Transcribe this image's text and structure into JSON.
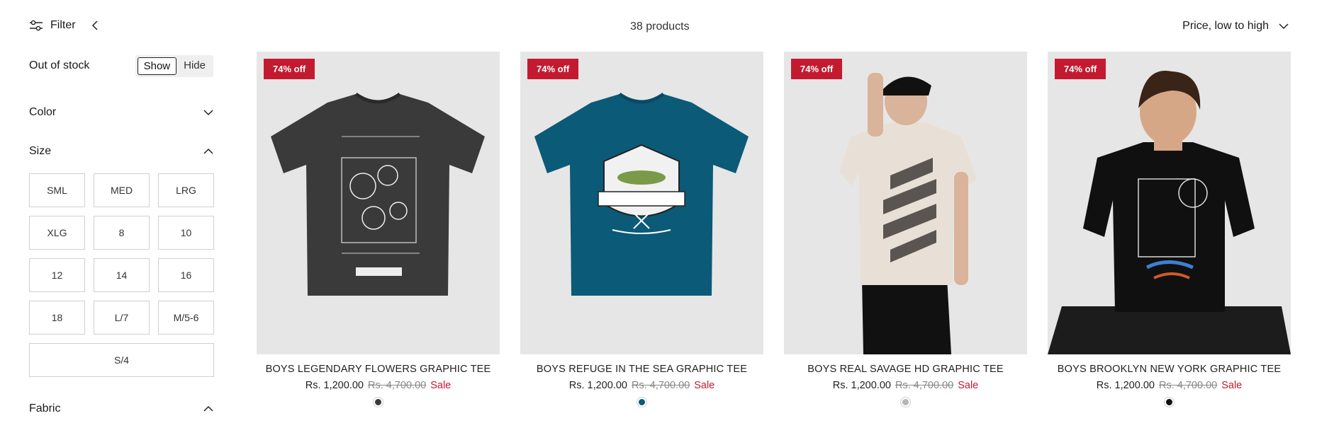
{
  "toolbar": {
    "filter_label": "Filter",
    "product_count": "38 products",
    "sort_label": "Price, low to high"
  },
  "sidebar": {
    "out_of_stock": {
      "label": "Out of stock",
      "options": [
        "Show",
        "Hide"
      ],
      "selected": "Show"
    },
    "color": {
      "label": "Color",
      "expanded": false
    },
    "size": {
      "label": "Size",
      "expanded": true,
      "options": [
        "SML",
        "MED",
        "LRG",
        "XLG",
        "8",
        "10",
        "12",
        "14",
        "16",
        "18",
        "L/7",
        "M/5-6",
        "S/4"
      ]
    },
    "fabric": {
      "label": "Fabric",
      "expanded": true
    }
  },
  "products": [
    {
      "badge": "74% off",
      "title": "BOYS LEGENDARY FLOWERS GRAPHIC TEE",
      "price": "Rs. 1,200.00",
      "compare_price": "Rs. 4,700.00",
      "sale_label": "Sale",
      "swatch": "#3a3a3a"
    },
    {
      "badge": "74% off",
      "title": "BOYS REFUGE IN THE SEA GRAPHIC TEE",
      "price": "Rs. 1,200.00",
      "compare_price": "Rs. 4,700.00",
      "sale_label": "Sale",
      "swatch": "#0b5a78"
    },
    {
      "badge": "74% off",
      "title": "BOYS REAL SAVAGE HD GRAPHIC TEE",
      "price": "Rs. 1,200.00",
      "compare_price": "Rs. 4,700.00",
      "sale_label": "Sale",
      "swatch": "#b5b5b5"
    },
    {
      "badge": "74% off",
      "title": "BOYS BROOKLYN NEW YORK GRAPHIC TEE",
      "price": "Rs. 1,200.00",
      "compare_price": "Rs. 4,700.00",
      "sale_label": "Sale",
      "swatch": "#111111"
    }
  ],
  "colors": {
    "accent_sale": "#c41a30",
    "image_bg": "#e6e6e6"
  }
}
